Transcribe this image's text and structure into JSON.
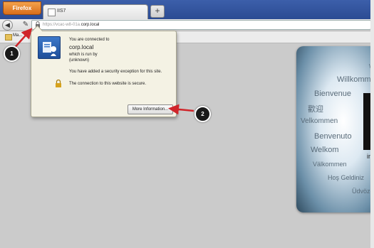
{
  "browser": {
    "menu_button_label": "Firefox",
    "tab_title": "IIS7",
    "new_tab_label": "+",
    "url_prefix": "https://vcac-w8-01a.",
    "url_domain": "corp.local",
    "bookmark_label": "Ma..."
  },
  "identity_popup": {
    "connected_label": "You are connected to",
    "domain": "corp.local",
    "run_by_label": "which is run by",
    "owner": "(unknown)",
    "exception_text": "You have added a security exception for this site.",
    "secure_text": "The connection to this website is secure.",
    "more_info_button": "More Information..."
  },
  "callouts": [
    "1",
    "2"
  ],
  "banner_words": [
    "W",
    "Willkommen",
    "Bienvenue",
    "歡迎",
    "Velkommen",
    "Benvenuto",
    "Welkom",
    "Välkommen",
    "Hoş Geldiniz",
    "Üdvözöl",
    "in"
  ],
  "colors": {
    "tabbar": "#2b4b93",
    "firefox_button": "#d86d1a",
    "annotation_arrow": "#d0252a",
    "popup_bg": "#f4f2e4"
  }
}
